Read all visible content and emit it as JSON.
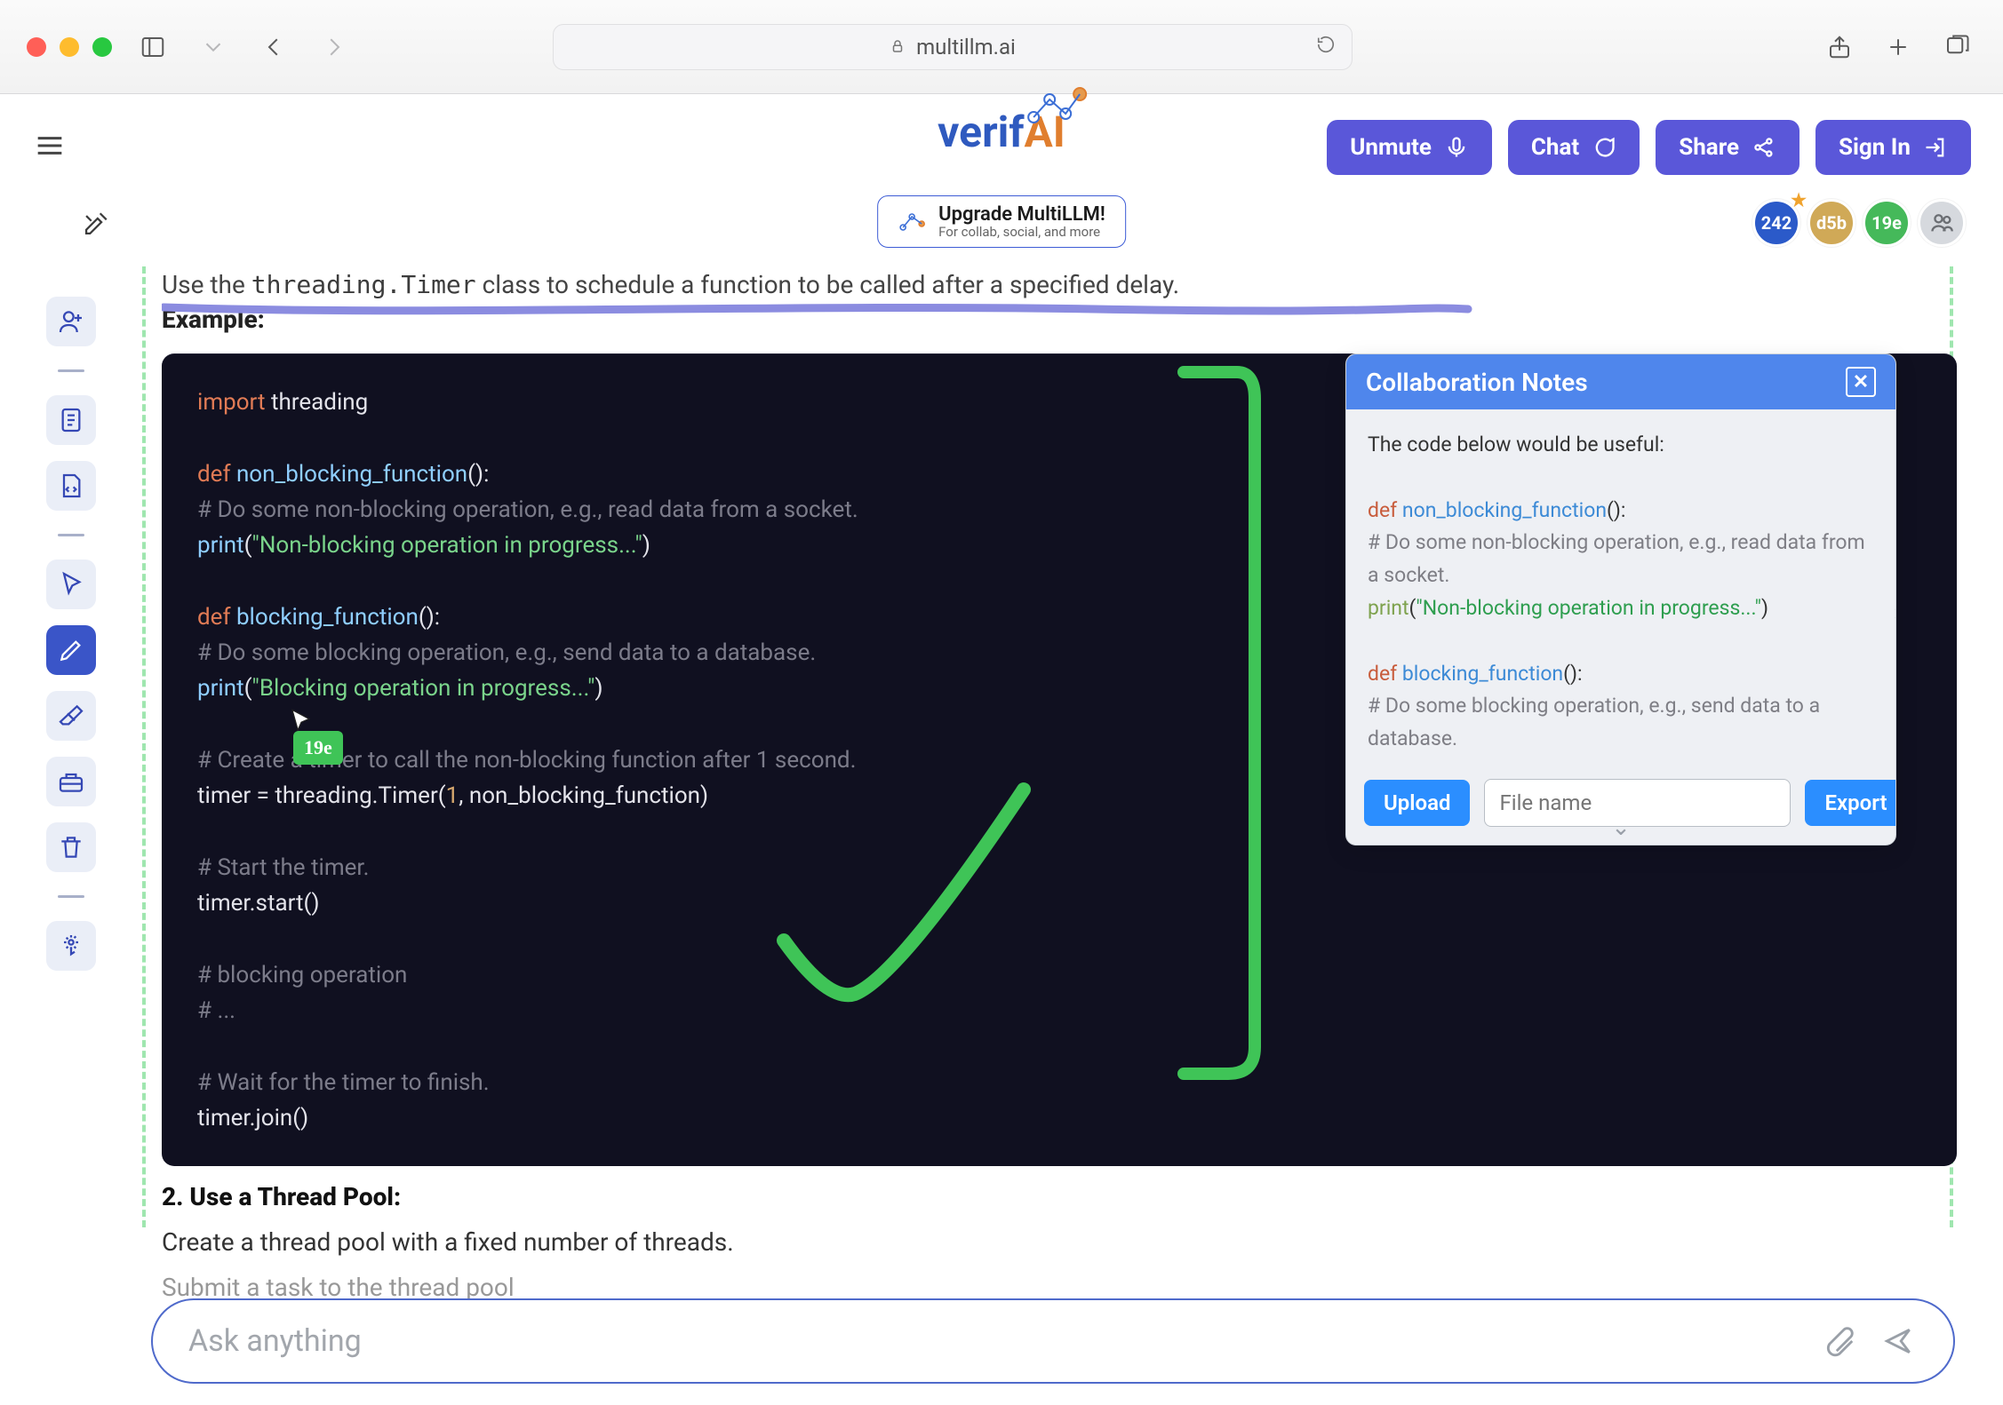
{
  "browser": {
    "url": "multillm.ai"
  },
  "header": {
    "logo_left": "verif",
    "logo_right": "AI",
    "upgrade_title": "Upgrade MultiLLM!",
    "upgrade_sub": "For collab, social, and more",
    "buttons": {
      "unmute": "Unmute",
      "chat": "Chat",
      "share": "Share",
      "signin": "Sign In"
    },
    "avatars": [
      "242",
      "d5b",
      "19e"
    ]
  },
  "content": {
    "intro_pre": "Use the ",
    "intro_code": "threading.Timer",
    "intro_post": " class to schedule a function to be called after a specified delay.",
    "example_label": "Example:",
    "code": {
      "l1a": "import",
      "l1b": " threading",
      "l3a": "def ",
      "l3b": "non_blocking_function",
      "l3c": "():",
      "l4": "    # Do some non-blocking operation, e.g., read data from a socket.",
      "l5a": "    ",
      "l5b": "print",
      "l5c": "(",
      "l5d": "\"Non-blocking operation in progress...\"",
      "l5e": ")",
      "l7a": "def ",
      "l7b": "blocking_function",
      "l7c": "():",
      "l8": "    # Do some blocking operation, e.g., send data to a database.",
      "l9a": "    ",
      "l9b": "print",
      "l9c": "(",
      "l9d": "\"Blocking operation in progress...\"",
      "l9e": ")",
      "l11": "# Create a timer to call the non-blocking function after 1 second.",
      "l12a": "timer = threading.Timer(",
      "l12b": "1",
      "l12c": ", non_blocking_function)",
      "l14": "# Start the timer.",
      "l15": "timer.start()",
      "l17": "# blocking operation",
      "l18": "# ...",
      "l20": "# Wait for the timer to finish.",
      "l21": "timer.join()"
    },
    "cursor_tag": "19e",
    "after_heading": "2. Use a Thread Pool:",
    "after_line1": "Create a thread pool with a fixed number of threads.",
    "after_line2": "Submit a task to the thread pool"
  },
  "collab": {
    "title": "Collaboration Notes",
    "lead": "The code below would be useful:",
    "c1a": "def ",
    "c1b": "non_blocking_function",
    "c1c": "():",
    "c2": "    # Do some non-blocking operation, e.g., read data from a socket.",
    "c3a": "    ",
    "c3b": "print",
    "c3c": "(",
    "c3d": "\"Non-blocking operation in progress...\"",
    "c3e": ")",
    "c5a": "def ",
    "c5b": "blocking_function",
    "c5c": "():",
    "c6": "    # Do some blocking operation, e.g., send data to a database.",
    "upload": "Upload",
    "export": "Export",
    "file_placeholder": "File name"
  },
  "ask": {
    "placeholder": "Ask anything"
  }
}
